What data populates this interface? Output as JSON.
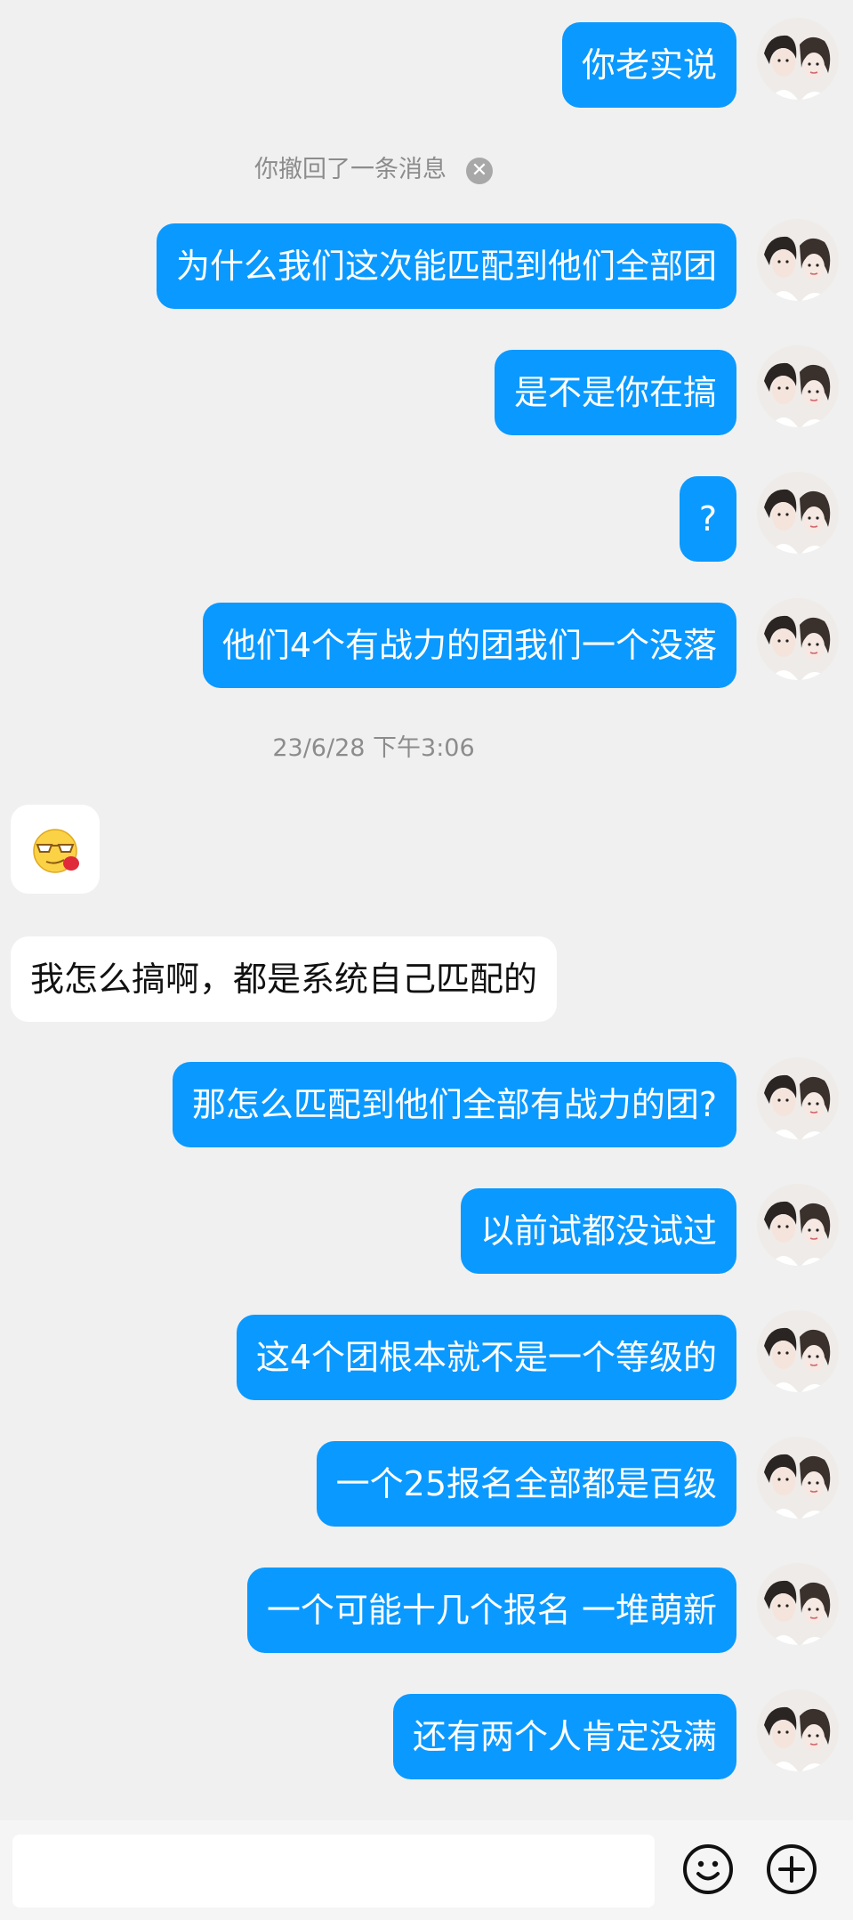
{
  "messages": [
    {
      "side": "me",
      "text": "你老实说"
    },
    {
      "type": "system",
      "text": "你撤回了一条消息"
    },
    {
      "side": "me",
      "text": "为什么我们这次能匹配到他们全部团"
    },
    {
      "side": "me",
      "text": "是不是你在搞"
    },
    {
      "side": "me",
      "text": "?"
    },
    {
      "side": "me",
      "text": "他们4个有战力的团我们一个没落"
    },
    {
      "type": "timestamp",
      "text": "23/6/28 下午3:06"
    },
    {
      "side": "them",
      "type": "emoji",
      "emoji": "sunglasses-tongue-emoji"
    },
    {
      "side": "them",
      "text": "我怎么搞啊，都是系统自己匹配的"
    },
    {
      "side": "me",
      "text": "那怎么匹配到他们全部有战力的团?"
    },
    {
      "side": "me",
      "text": "以前试都没试过"
    },
    {
      "side": "me",
      "text": "这4个团根本就不是一个等级的"
    },
    {
      "side": "me",
      "text": "一个25报名全部都是百级"
    },
    {
      "side": "me",
      "text": "一个可能十几个报名 一堆萌新"
    },
    {
      "side": "me",
      "text": "还有两个人肯定没满"
    }
  ],
  "input": {
    "placeholder": "",
    "value": ""
  },
  "icons": {
    "emoji_button": "smiley-icon",
    "more_button": "plus-circle-icon"
  },
  "colors": {
    "my_bubble": "#0a99ff",
    "their_bubble": "#ffffff",
    "background": "#f0f0f0"
  }
}
